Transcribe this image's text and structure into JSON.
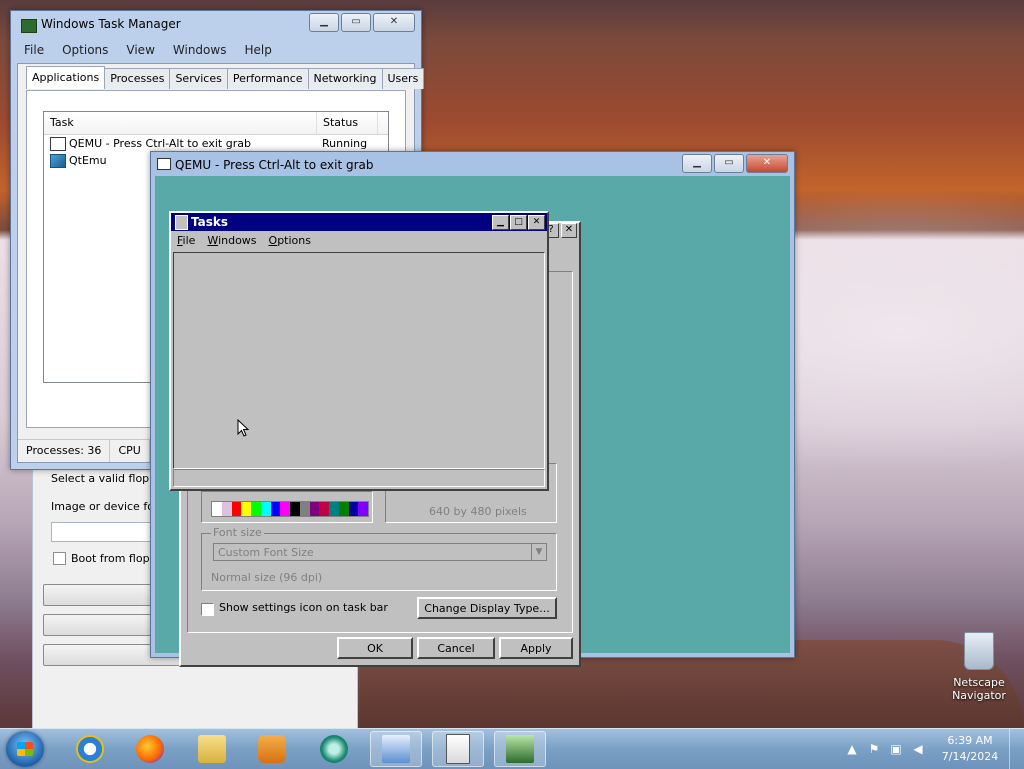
{
  "desktop": {
    "recycle_label": "Netscape Navigator"
  },
  "task_manager": {
    "title": "Windows Task Manager",
    "menu": [
      "File",
      "Options",
      "View",
      "Windows",
      "Help"
    ],
    "tabs": [
      "Applications",
      "Processes",
      "Services",
      "Performance",
      "Networking",
      "Users"
    ],
    "active_tab": "Applications",
    "columns": [
      "Task",
      "Status"
    ],
    "rows": [
      {
        "task": "QEMU - Press Ctrl-Alt to exit grab",
        "status": "Running"
      },
      {
        "task": "QtEmu",
        "status": ""
      }
    ],
    "status_processes": "Processes: 36",
    "status_cpu": "CPU"
  },
  "qtemu_behind": {
    "select_floppy": "Select a valid floppy",
    "image_device": "Image or device for",
    "boot_floppy": "Boot from floppy"
  },
  "qemu": {
    "title": "QEMU - Press Ctrl-Alt to exit grab",
    "display_dialog": {
      "resolution": "640 by 480 pixels",
      "font_size_label": "Font size",
      "font_size_value": "Custom Font Size",
      "font_size_note": "Normal size (96 dpi)",
      "show_settings_icon": "Show settings icon on task bar",
      "change_display_type": "Change Display Type...",
      "ok": "OK",
      "cancel": "Cancel",
      "apply": "Apply",
      "help_glyph": "?",
      "close_glyph": "✕",
      "palette": [
        "#ffffff",
        "#e0c0e0",
        "#ff0000",
        "#ffff00",
        "#00ff00",
        "#00ffff",
        "#0000ff",
        "#ff00ff",
        "#000000",
        "#808080",
        "#800080",
        "#c00040",
        "#008080",
        "#008000",
        "#0000a0",
        "#8000ff"
      ]
    },
    "tasks_window": {
      "title": "Tasks",
      "menu": [
        "File",
        "Windows",
        "Options"
      ]
    }
  },
  "taskbar": {
    "clock_time": "6:39 AM",
    "clock_date": "7/14/2024",
    "tray_expand": "▲"
  }
}
